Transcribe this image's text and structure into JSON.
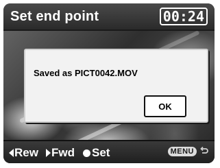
{
  "header": {
    "title": "Set end point",
    "timecode": "00:24"
  },
  "dialog": {
    "message": "Saved as PICT0042.MOV",
    "ok_label": "OK"
  },
  "footer": {
    "rew_label": "Rew",
    "fwd_label": "Fwd",
    "set_label": "Set",
    "menu_label": "MENU"
  },
  "icons": {
    "rew": "triangle-left-icon",
    "fwd": "triangle-right-icon",
    "set": "filled-circle-icon",
    "back": "return-arrow-icon"
  }
}
